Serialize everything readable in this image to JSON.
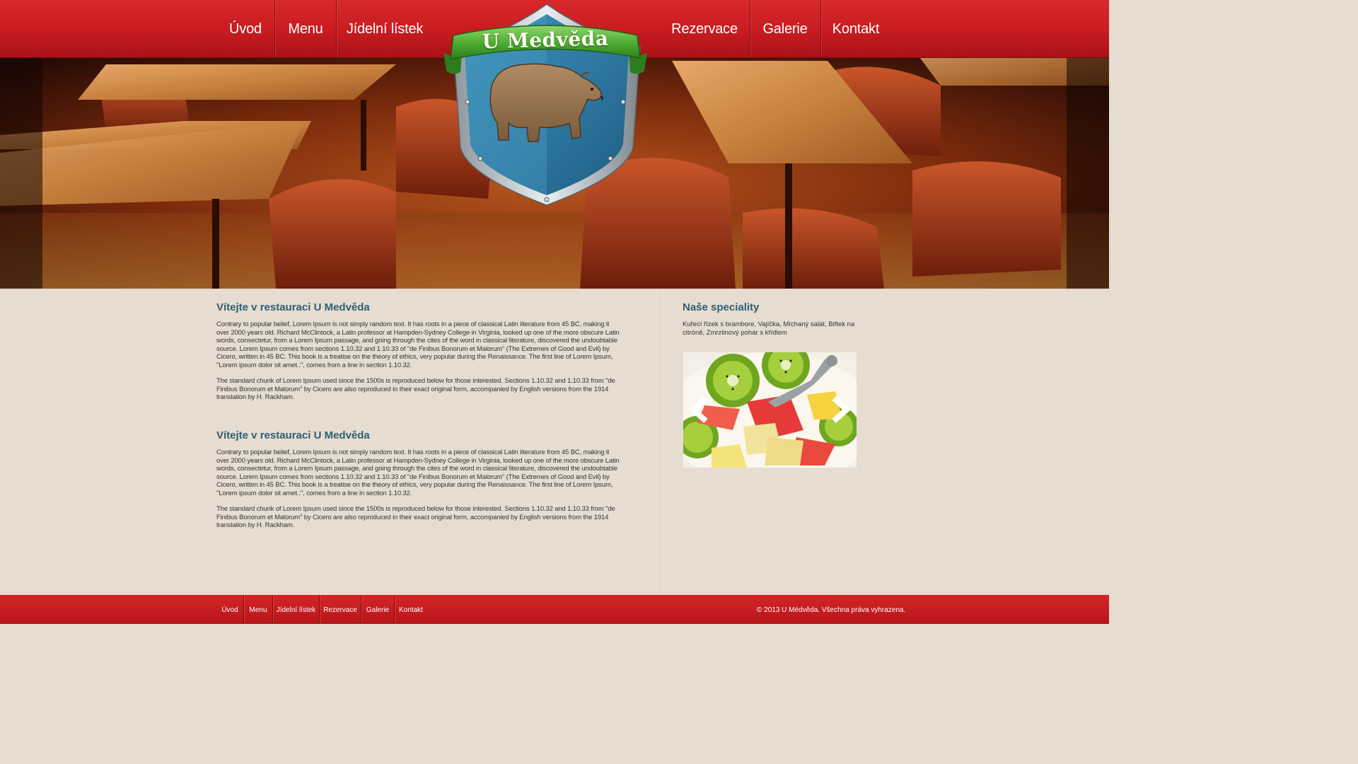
{
  "nav": {
    "items": [
      "Úvod",
      "Menu",
      "Jídelní lístek",
      "Rezervace",
      "Galerie",
      "Kontakt"
    ]
  },
  "logo": {
    "text": "U Medvěda",
    "icon": "bear-shield-icon"
  },
  "main": {
    "sections": [
      {
        "title": "Vítejte v restauraci U Medvěda",
        "paragraphs": [
          "Contrary to popular belief, Lorem Ipsum is not simply random text. It has roots in a piece of classical Latin literature from 45 BC, making it over 2000 years old. Richard McClintock, a Latin professor at Hampden-Sydney College in Virginia, looked up one of the more obscure Latin words, consectetur, from a Lorem Ipsum passage, and going through the cites of the word in classical literature, discovered the undoubtable source. Lorem Ipsum comes from sections 1.10.32 and 1.10.33 of \"de Finibus Bonorum et Malorum\" (The Extremes of Good and Evil) by Cicero, written in 45 BC. This book is a treatise on the theory of ethics, very popular during the Renaissance. The first line of Lorem Ipsum, \"Lorem ipsum dolor sit amet..\", comes from a line in section 1.10.32.",
          "The standard chunk of Lorem Ipsum used since the 1500s is reproduced below for those interested. Sections 1.10.32 and 1.10.33 from \"de Finibus Bonorum et Malorum\" by Cicero are also reproduced in their exact original form, accompanied by English versions from the 1914 translation by H. Rackham."
        ]
      },
      {
        "title": "Vítejte v restauraci U Medvěda",
        "paragraphs": [
          "Contrary to popular belief, Lorem Ipsum is not simply random text. It has roots in a piece of classical Latin literature from 45 BC, making it over 2000 years old. Richard McClintock, a Latin professor at Hampden-Sydney College in Virginia, looked up one of the more obscure Latin words, consectetur, from a Lorem Ipsum passage, and going through the cites of the word in classical literature, discovered the undoubtable source. Lorem Ipsum comes from sections 1.10.32 and 1.10.33 of \"de Finibus Bonorum et Malorum\" (The Extremes of Good and Evil) by Cicero, written in 45 BC. This book is a treatise on the theory of ethics, very popular during the Renaissance. The first line of Lorem Ipsum, \"Lorem ipsum dolor sit amet..\", comes from a line in section 1.10.32.",
          "The standard chunk of Lorem Ipsum used since the 1500s is reproduced below for those interested. Sections 1.10.32 and 1.10.33 from \"de Finibus Bonorum et Malorum\" by Cicero are also reproduced in their exact original form, accompanied by English versions from the 1914 translation by H. Rackham."
        ]
      }
    ]
  },
  "sidebar": {
    "title": "Naše speciality",
    "text": "Kuřecí řízek s brambore, Vajíčka, Míchaný salát, Biftek na citróně, Zmrzlinový pohár s křídlem",
    "slider": {
      "prev_icon": "chevron-left-icon",
      "next_icon": "chevron-right-icon"
    }
  },
  "footer": {
    "items": [
      "Úvod",
      "Menu",
      "Jídelní lístek",
      "Rezervace",
      "Galerie",
      "Kontakt"
    ],
    "copyright": "© 2013 U Médvěda. Všechna práva vyhrazena."
  },
  "colors": {
    "accent_red": "#c81c20",
    "heading_blue": "#2d5f74",
    "background": "#e6dcd0"
  }
}
